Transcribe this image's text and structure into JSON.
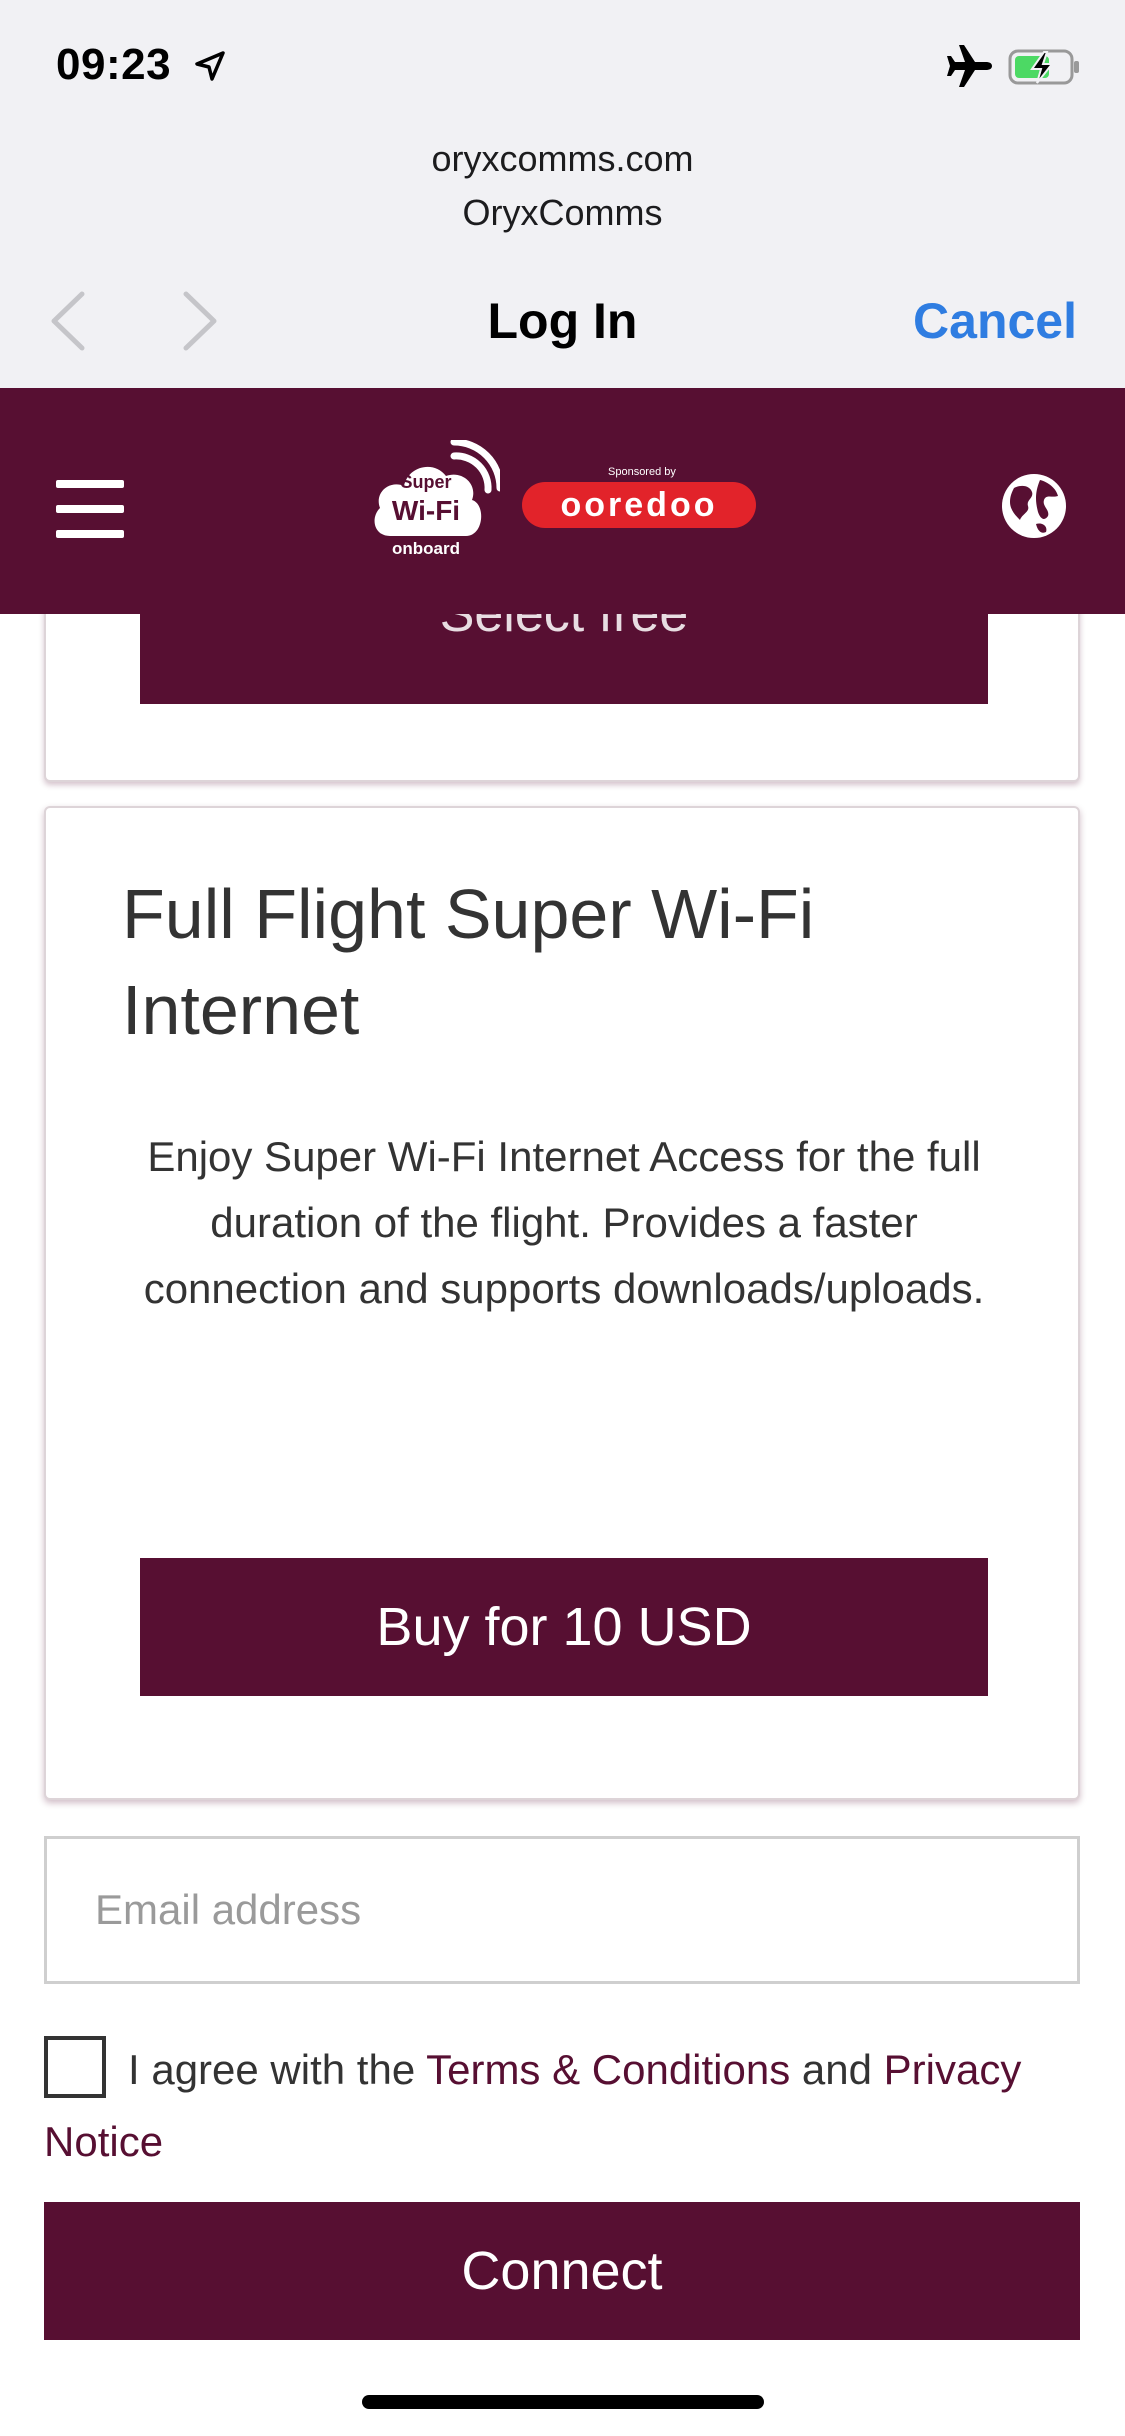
{
  "status_bar": {
    "time": "09:23",
    "location_icon": "location-arrow-icon",
    "airplane_icon": "airplane-icon",
    "battery_icon": "battery-charging-icon",
    "battery_color": "#4cd964"
  },
  "sheet": {
    "domain": "oryxcomms.com",
    "site_name": "OryxComms",
    "title": "Log In",
    "cancel_label": "Cancel",
    "back_icon": "chevron-left-icon",
    "forward_icon": "chevron-right-icon",
    "accent_color": "#2f7de1"
  },
  "app_header": {
    "logo_line1": "Super",
    "logo_line2": "Wi-Fi",
    "logo_line3": "onboard",
    "sponsored_text": "Sponsored by",
    "sponsor_logo_text": "ooredoo",
    "brand_color": "#570f32",
    "sponsor_color": "#e2232a"
  },
  "previous_card": {
    "button_label": "Select free"
  },
  "plan_card": {
    "title": "Full Flight Super Wi-Fi Internet",
    "description": "Enjoy Super Wi-Fi Internet Access for the full duration of the flight. Provides a faster connection and supports downloads/uploads.",
    "buy_label": "Buy for 10 USD"
  },
  "form": {
    "email_placeholder": "Email address",
    "email_value": "",
    "agree_prefix": "I agree with the",
    "terms_label": "Terms & Conditions",
    "agree_and": "and",
    "privacy_label": "Privacy Notice",
    "agree_checked": false,
    "connect_label": "Connect"
  }
}
